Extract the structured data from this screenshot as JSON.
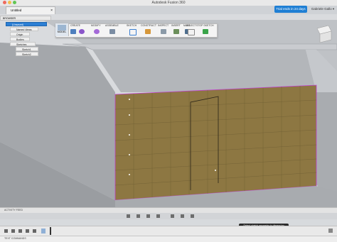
{
  "window": {
    "title": "Autodesk Fusion 360"
  },
  "tabs": [
    {
      "label": "Untitled"
    }
  ],
  "header": {
    "trial_label": "Trial ends in 24 days",
    "user_label": "Gabriele Gallo ▾"
  },
  "toolbar": {
    "workspace_label": "MODEL",
    "groups": [
      {
        "label": "CREATE"
      },
      {
        "label": "MODIFY"
      },
      {
        "label": "ASSEMBLE"
      },
      {
        "label": "SKETCH"
      },
      {
        "label": "CONSTRUCT"
      },
      {
        "label": "INSPECT"
      },
      {
        "label": "INSERT"
      },
      {
        "label": "MAKE"
      },
      {
        "label": "SELECT"
      },
      {
        "label": "STOP SKETCH"
      }
    ]
  },
  "browser": {
    "header": "BROWSER",
    "items": [
      {
        "label": "(Unsaved)"
      },
      {
        "label": "Named Views"
      },
      {
        "label": "Origin"
      },
      {
        "label": "Bodies"
      },
      {
        "label": "Sketches"
      },
      {
        "label": "Sketch1"
      },
      {
        "label": "Sketch2"
      }
    ]
  },
  "activity": {
    "label": "ACTIVITY FEED"
  },
  "status": {
    "hint": "Select sketch geometry to dimension"
  },
  "commands": {
    "label": "TEXT COMMANDS"
  },
  "colors": {
    "accent": "#1f7fd4",
    "selected_face": "#8d7742",
    "sketch_line": "#c13fd0"
  }
}
